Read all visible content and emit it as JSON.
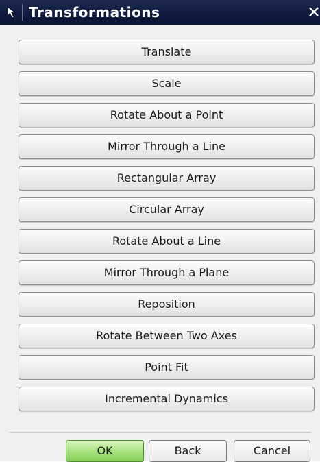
{
  "window": {
    "title": "Transformations",
    "close_symbol": "✕",
    "title_icon": "arrow-cursor-icon"
  },
  "actions": [
    {
      "label": "Translate"
    },
    {
      "label": "Scale"
    },
    {
      "label": "Rotate About a Point"
    },
    {
      "label": "Mirror Through a Line"
    },
    {
      "label": "Rectangular Array"
    },
    {
      "label": "Circular Array"
    },
    {
      "label": "Rotate About a Line"
    },
    {
      "label": "Mirror Through a Plane"
    },
    {
      "label": "Reposition"
    },
    {
      "label": "Rotate Between Two Axes"
    },
    {
      "label": "Point Fit"
    },
    {
      "label": "Incremental Dynamics"
    }
  ],
  "footer": {
    "ok_label": "OK",
    "back_label": "Back",
    "cancel_label": "Cancel",
    "ok_color": "#9fdc76"
  }
}
